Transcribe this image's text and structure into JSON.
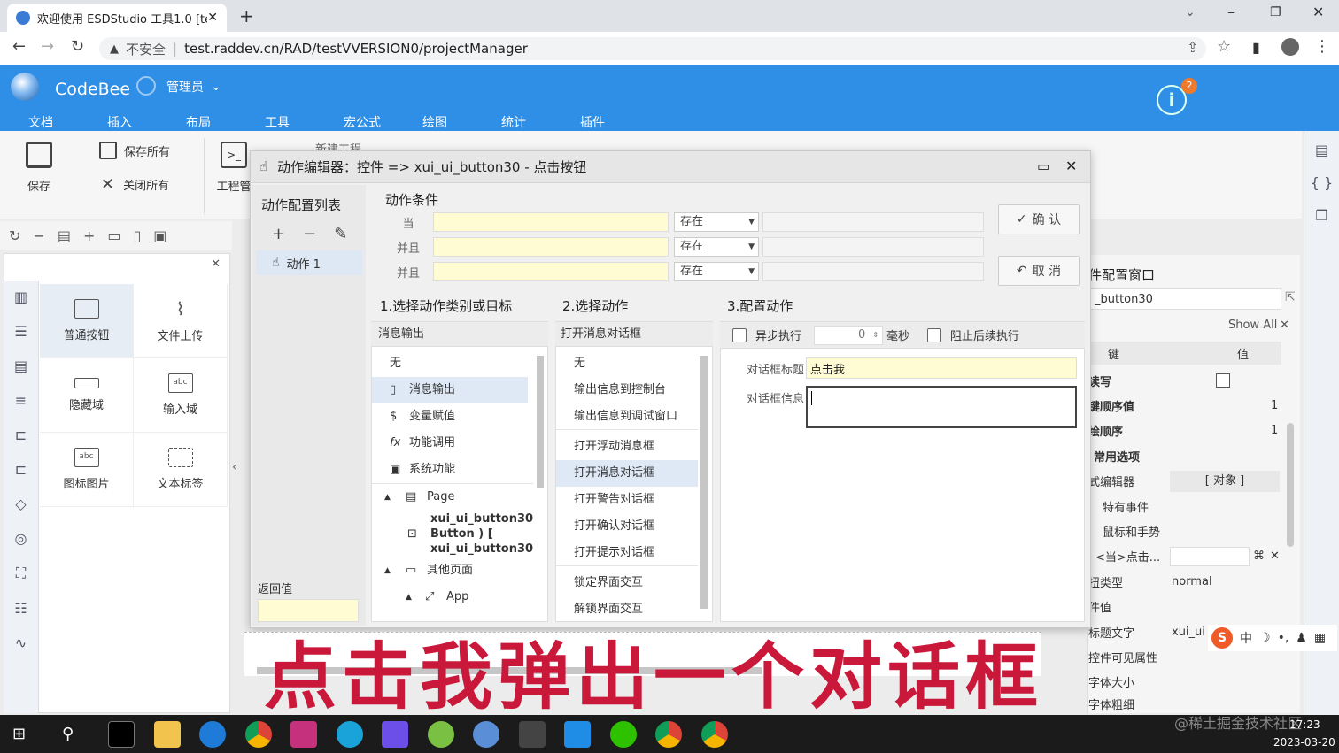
{
  "browser": {
    "tab_title": "欢迎使用 ESDStudio 工具1.0 [te",
    "not_secure": "不安全",
    "url": "test.raddev.cn/RAD/testVVERSION0/projectManager"
  },
  "app": {
    "name": "CodeBee",
    "user": "管理员",
    "notification_count": "2",
    "menu": [
      "文档",
      "插入",
      "布局",
      "工具",
      "宏公式",
      "绘图",
      "统计",
      "插件"
    ]
  },
  "ribbon": {
    "save": "保存",
    "save_all": "保存所有",
    "close_all": "关闭所有",
    "project": "工程管",
    "new_project": "新建工程"
  },
  "left_panel": {
    "components": [
      "普通按钮",
      "文件上传",
      "隐藏域",
      "输入域",
      "图标图片",
      "文本标签"
    ],
    "icon_labels": [
      "abc",
      "abc"
    ]
  },
  "dialog": {
    "title": "动作编辑器：控件 => xui_ui_button30 - 点击按钮",
    "action_list_title": "动作配置列表",
    "action_item": "动作 1",
    "return_label": "返回值",
    "condition_title": "动作条件",
    "conditions": [
      {
        "label": "当",
        "op": "存在"
      },
      {
        "label": "并且",
        "op": "存在"
      },
      {
        "label": "并且",
        "op": "存在"
      }
    ],
    "confirm": "确 认",
    "cancel": "取 消",
    "col1_title": "1.选择动作类别或目标",
    "col1_sub": "消息输出",
    "col1_items": [
      "无",
      "消息输出",
      "变量赋值",
      "功能调用",
      "系统功能"
    ],
    "col1_tree": {
      "page": "Page",
      "button_line1": "xui_ui_button30",
      "button_line2": "Button ) [",
      "button_line3": "xui_ui_button30",
      "other": "其他页面",
      "app": "App"
    },
    "col2_title": "2.选择动作",
    "col2_sub": "打开消息对话框",
    "col2_items": [
      "无",
      "输出信息到控制台",
      "输出信息到调试窗口",
      "打开浮动消息框",
      "打开消息对话框",
      "打开警告对话框",
      "打开确认对话框",
      "打开提示对话框",
      "锁定界面交互",
      "解锁界面交互"
    ],
    "col3_title": "3.配置动作",
    "async_label": "异步执行",
    "delay_value": "0",
    "ms_label": "毫秒",
    "block_label": "阻止后续执行",
    "dlg_title_label": "对话框标题",
    "dlg_title_value": "点击我",
    "dlg_info_label": "对话框信息"
  },
  "right_panel": {
    "title": "件配置窗口",
    "object_name": "_button30",
    "show_all": "Show All",
    "col_key": "键",
    "col_value": "值",
    "rows": [
      {
        "key": "读写",
        "val": ""
      },
      {
        "key": "键顺序值",
        "val": "1"
      },
      {
        "key": "绘顺序",
        "val": "1"
      },
      {
        "key": "常用选项",
        "val": ""
      },
      {
        "key": "式编辑器",
        "val": "[ 对象 ]"
      },
      {
        "key": "特有事件",
        "val": ""
      },
      {
        "key": "鼠标和手势",
        "val": ""
      },
      {
        "key": "<当>点击...",
        "val": ""
      },
      {
        "key": "扭类型",
        "val": "normal"
      },
      {
        "key": "件值",
        "val": ""
      },
      {
        "key": "标题文字",
        "val": "xui_ui"
      },
      {
        "key": "控件可见属性",
        "val": ""
      },
      {
        "key": "字体大小",
        "val": ""
      },
      {
        "key": "字体粗细",
        "val": ""
      }
    ]
  },
  "overlay_text": "点击我弹出一个对话框",
  "watermark": "@稀土掘金技术社区",
  "clock": {
    "time": "17:23",
    "date": "2023-03-20"
  },
  "colors": {
    "app_blue": "#2f8ee5",
    "overlay_red": "#c9183a",
    "input_yellow": "#fffbd3"
  }
}
